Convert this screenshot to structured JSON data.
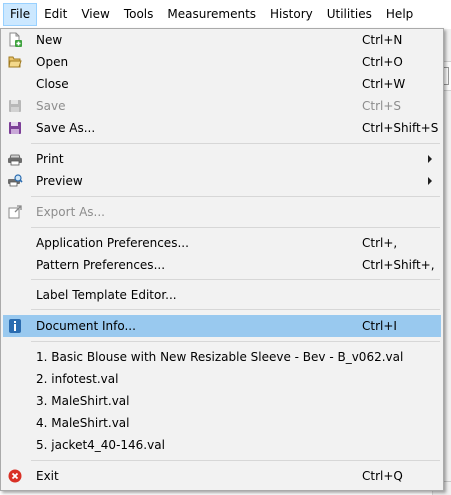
{
  "menubar": {
    "items": [
      {
        "label": "File"
      },
      {
        "label": "Edit"
      },
      {
        "label": "View"
      },
      {
        "label": "Tools"
      },
      {
        "label": "Measurements"
      },
      {
        "label": "History"
      },
      {
        "label": "Utilities"
      },
      {
        "label": "Help"
      }
    ],
    "active_item": "File"
  },
  "file_menu": {
    "items": {
      "new": {
        "label": "New",
        "shortcut": "Ctrl+N",
        "icon": "new-document-icon"
      },
      "open": {
        "label": "Open",
        "shortcut": "Ctrl+O",
        "icon": "open-folder-icon"
      },
      "close": {
        "label": "Close",
        "shortcut": "Ctrl+W"
      },
      "save": {
        "label": "Save",
        "shortcut": "Ctrl+S",
        "icon": "save-icon",
        "enabled": false
      },
      "save_as": {
        "label": "Save As...",
        "shortcut": "Ctrl+Shift+S",
        "icon": "save-as-icon"
      },
      "print": {
        "label": "Print",
        "icon": "printer-icon",
        "has_submenu": true
      },
      "preview": {
        "label": "Preview",
        "icon": "print-preview-icon",
        "has_submenu": true
      },
      "export_as": {
        "label": "Export As...",
        "icon": "export-icon",
        "enabled": false
      },
      "app_prefs": {
        "label": "Application Preferences...",
        "shortcut": "Ctrl+,"
      },
      "pattern_prefs": {
        "label": "Pattern Preferences...",
        "shortcut": "Ctrl+Shift+,"
      },
      "label_template": {
        "label": "Label Template Editor..."
      },
      "document_info": {
        "label": "Document Info...",
        "shortcut": "Ctrl+I",
        "icon": "info-icon",
        "highlighted": true
      },
      "exit": {
        "label": "Exit",
        "shortcut": "Ctrl+Q",
        "icon": "exit-icon"
      }
    },
    "recent_files": [
      "1. Basic Blouse with New Resizable Sleeve - Bev - B_v062.val",
      "2. infotest.val",
      "3. MaleShirt.val",
      "4. MaleShirt.val",
      "5. jacket4_40-146.val"
    ]
  },
  "colors": {
    "menubar_active_bg": "#cce8ff",
    "menu_bg": "#f2f2f2",
    "highlight_bg": "#99c9ef",
    "disabled_text": "#8d8d8d"
  }
}
